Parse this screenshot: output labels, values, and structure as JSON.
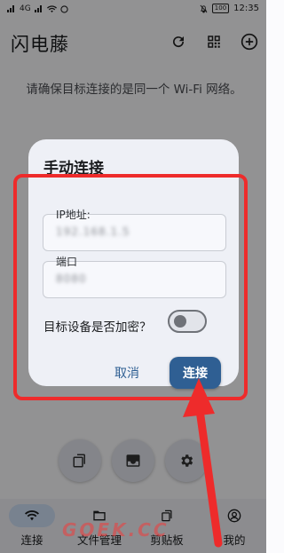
{
  "status_bar": {
    "network_badge": "4G",
    "battery": "100",
    "time": "12:35"
  },
  "app": {
    "title": "闪电藤",
    "hint": "请确保目标连接的是同一个 Wi-Fi 网络。"
  },
  "dialog": {
    "title": "手动连接",
    "ip_label": "IP地址:",
    "ip_value": "192.168.1.5",
    "port_label": "端口",
    "port_value": "8080",
    "encrypt_label": "目标设备是否加密？",
    "encrypt_on": false,
    "cancel_label": "取消",
    "connect_label": "连接"
  },
  "nav": {
    "items": [
      {
        "label": "连接",
        "icon": "wifi-icon",
        "active": true
      },
      {
        "label": "文件管理",
        "icon": "folder-icon",
        "active": false
      },
      {
        "label": "剪贴板",
        "icon": "copy-icon",
        "active": false
      },
      {
        "label": "我的",
        "icon": "account-icon",
        "active": false
      }
    ]
  },
  "watermark": "GOEK.CC",
  "colors": {
    "accent": "#2f5f93",
    "annotation": "#ee2b2b",
    "nav_active": "#cfe0f6"
  }
}
